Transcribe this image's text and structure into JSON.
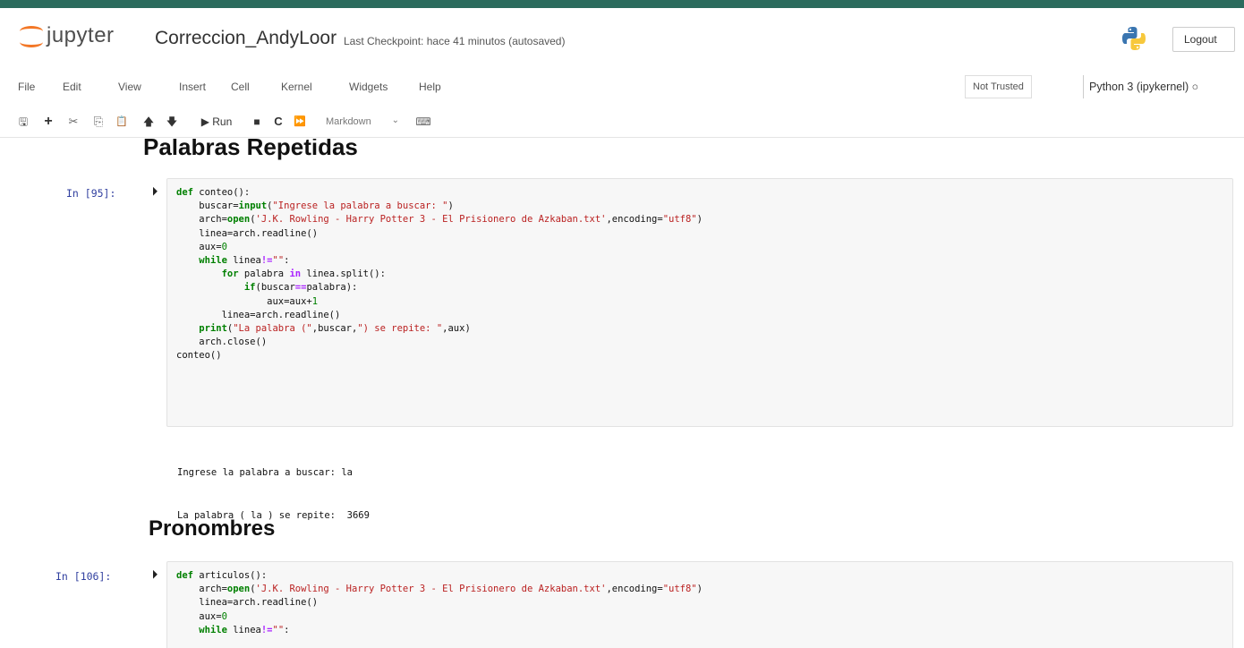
{
  "header": {
    "logo_text": "jupyter",
    "notebook_title": "Correccion_AndyLoor",
    "checkpoint": "Last Checkpoint: hace 41 minutos  (autosaved)",
    "logout_label": "Logout"
  },
  "menu": {
    "items": [
      "File",
      "Edit",
      "View",
      "Insert",
      "Cell",
      "Kernel",
      "Widgets",
      "Help"
    ],
    "trust_status": "Not Trusted",
    "kernel": "Python 3 (ipykernel)"
  },
  "toolbar": {
    "buttons": [
      {
        "icon": "save-icon",
        "glyph": "🖫"
      },
      {
        "icon": "plus-icon",
        "glyph": "+"
      },
      {
        "icon": "cut-icon",
        "glyph": "✂"
      },
      {
        "icon": "copy-icon",
        "glyph": "⎘"
      },
      {
        "icon": "paste-icon",
        "glyph": "📋"
      },
      {
        "icon": "arrow-up-icon",
        "glyph": "🡅"
      },
      {
        "icon": "arrow-down-icon",
        "glyph": "🡇"
      }
    ],
    "run_label": "▶ Run",
    "stop_glyph": "■",
    "restart_glyph": "C",
    "fastforward_glyph": "⏩",
    "cell_type": "Markdown",
    "keyboard_glyph": "⌨"
  },
  "cells": {
    "heading1": "Palabras Repetidas",
    "cell1_prompt": "In [95]:",
    "cell1_output": [
      "Ingrese la palabra a buscar: la",
      "La palabra ( la ) se repite:  3669"
    ],
    "heading2": "Pronombres",
    "cell2_prompt": "In [106]:",
    "run_glyph": "⏵"
  },
  "code": {
    "cell1": [
      "def conteo():",
      "    buscar=input(\"Ingrese la palabra a buscar: \")",
      "    arch=open('J.K. Rowling - Harry Potter 3 - El Prisionero de Azkaban.txt',encoding=\"utf8\")",
      "    linea=arch.readline()",
      "    aux=0",
      "    while linea!=\"\":",
      "        for palabra in linea.split():",
      "            if(buscar==palabra):",
      "                aux=aux+1",
      "        linea=arch.readline()",
      "    print(\"La palabra (\",buscar,\") se repite: \",aux)",
      "    arch.close()",
      "conteo()"
    ],
    "cell2": [
      "def articulos():",
      "    arch=open('J.K. Rowling - Harry Potter 3 - El Prisionero de Azkaban.txt',encoding=\"utf8\")",
      "    linea=arch.readline()",
      "    aux=0",
      "    while linea!=\"\":"
    ]
  },
  "colors": {
    "top_strip": "#2b6b5d",
    "jupyter_orange": "#f37726",
    "prompt_blue": "#303f9f",
    "keyword_green": "#008000",
    "string_red": "#ba2121"
  }
}
